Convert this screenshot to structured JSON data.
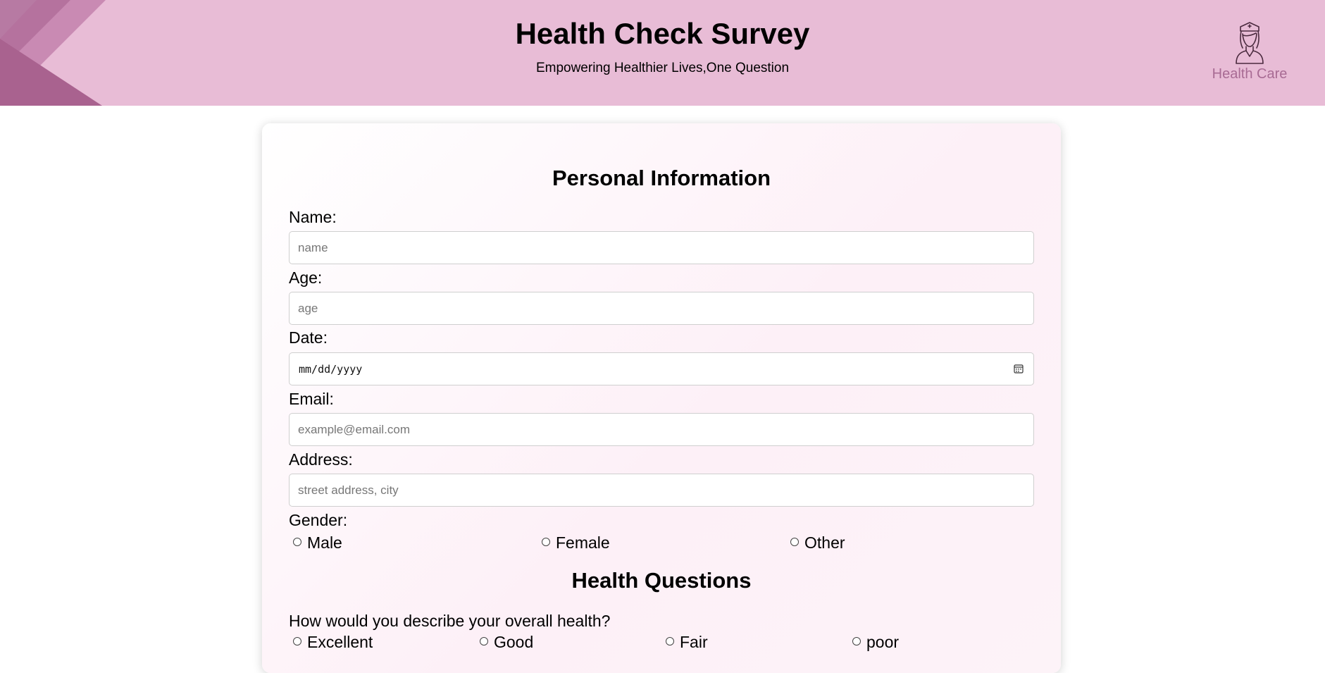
{
  "header": {
    "title": "Health Check Survey",
    "tagline": "Empowering Healthier Lives,One Question",
    "brand_label": "Health Care",
    "brand_icon": "nurse-icon",
    "colors": {
      "header_bg": "#e8bcd6",
      "accent": "#a86b94"
    }
  },
  "personal_section": {
    "title": "Personal Information",
    "fields": {
      "name": {
        "label": "Name:",
        "placeholder": "name",
        "value": ""
      },
      "age": {
        "label": "Age:",
        "placeholder": "age",
        "value": ""
      },
      "date": {
        "label": "Date:",
        "value": "mm/dd/yyyy",
        "icon": "calendar-icon"
      },
      "email": {
        "label": "Email:",
        "placeholder": "example@email.com",
        "value": ""
      },
      "address": {
        "label": "Address:",
        "placeholder": "street address, city",
        "value": ""
      }
    },
    "gender": {
      "label": "Gender:",
      "options": [
        "Male",
        "Female",
        "Other"
      ]
    }
  },
  "health_section": {
    "title": "Health Questions",
    "overall_health": {
      "question": "How would you describe your overall health?",
      "options": [
        "Excellent",
        "Good",
        "Fair",
        "poor"
      ]
    }
  }
}
